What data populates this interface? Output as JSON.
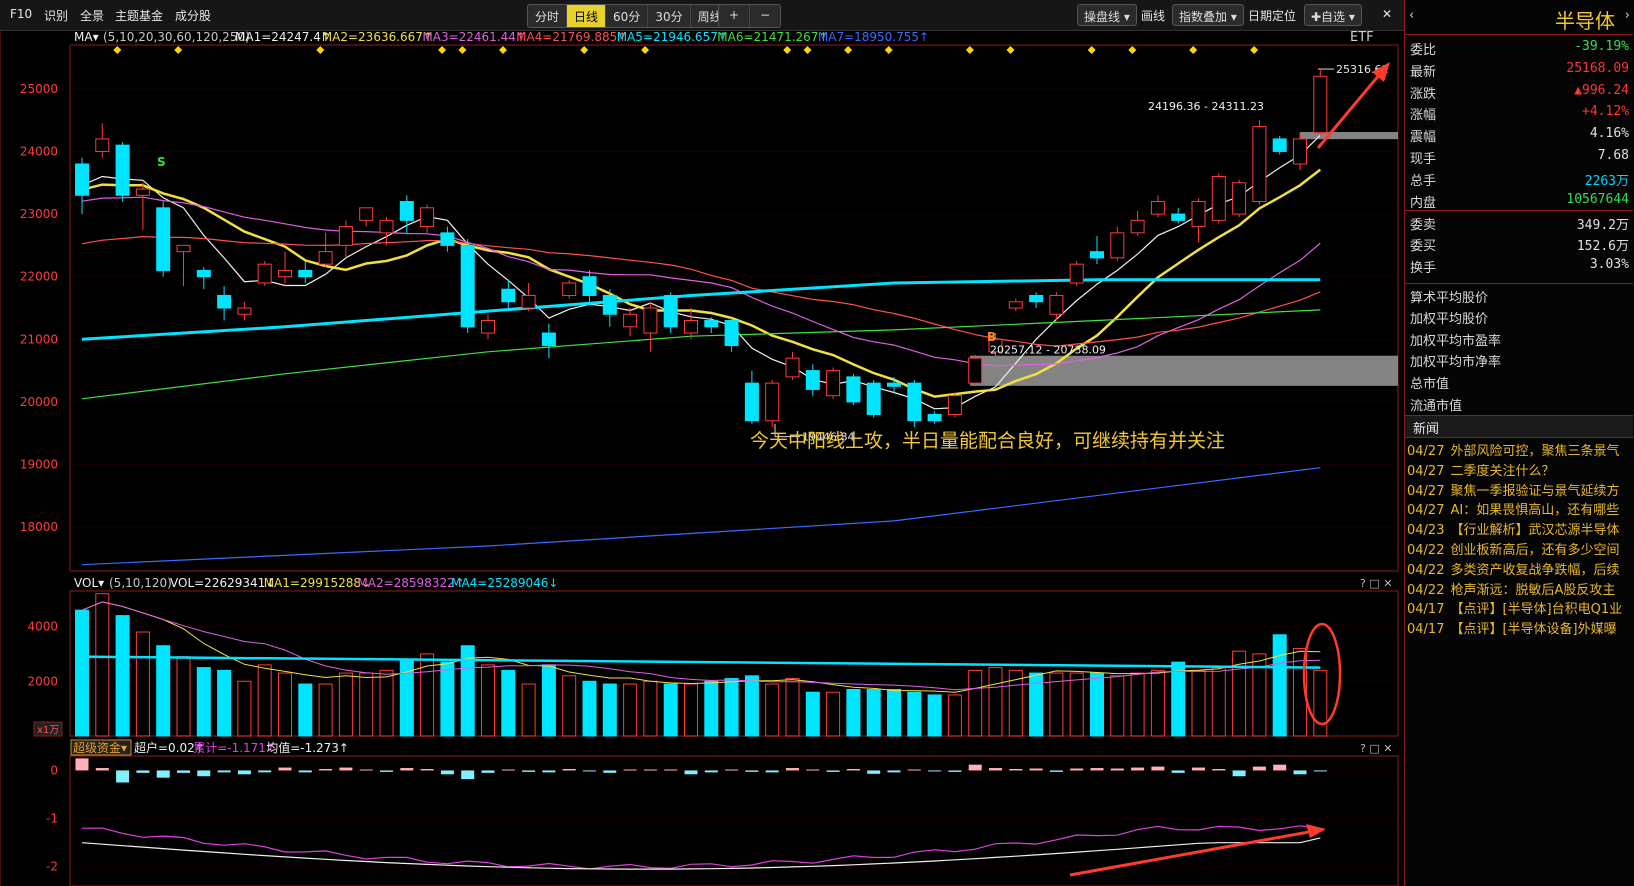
{
  "toolbar": {
    "f10": "F10",
    "identify": "识别",
    "overview": "全景",
    "theme_fund": "主题基金",
    "constituents": "成分股",
    "periods": [
      "分时",
      "日线",
      "60分",
      "30分",
      "周线 ▾"
    ],
    "active_period": 1,
    "zoom_in": "+",
    "zoom_out": "−",
    "chips": "操盘线 ▾",
    "draw": "画线",
    "index_overlay": "指数叠加 ▾",
    "date_locate": "日期定位",
    "add_fav": "✚自选 ▾",
    "close": "✕"
  },
  "main_header": {
    "ma_btn": "MA▾",
    "params": "(5,10,20,30,60,120,250)",
    "ma_values": [
      {
        "text": "MA1=24247.4↑",
        "color": "#f0f0f0"
      },
      {
        "text": "MA2=23636.667↑",
        "color": "#f0e040"
      },
      {
        "text": "MA3=22461.44↑",
        "color": "#e060e0"
      },
      {
        "text": "MA4=21769.885↑",
        "color": "#ff5050"
      },
      {
        "text": "MA5=21946.657↑",
        "color": "#00e5ff"
      },
      {
        "text": "MA6=21471.267↑",
        "color": "#40e040"
      },
      {
        "text": "MA7=18950.755↑",
        "color": "#3a6bff"
      }
    ],
    "etf": "ETF"
  },
  "annotations": {
    "high": "25316.61",
    "range1": "24196.36 - 24311.23",
    "range2": "20257.12 - 20738.09",
    "low": "19446.84",
    "comment": "今天中阳线上攻，半日量能配合良好，可继续持有并关注",
    "buy_marker": "B",
    "sell_marker": "S"
  },
  "vol_header": {
    "btn": "VOL▾",
    "params": "(5,10,120)",
    "values": [
      {
        "text": "VOL=22629341↓",
        "color": "#f0f0f0"
      },
      {
        "text": "MA1=29915288↓",
        "color": "#f0e040"
      },
      {
        "text": "MA2=28598322↑",
        "color": "#e060e0"
      },
      {
        "text": "MA4=25289046↓",
        "color": "#00e5ff"
      }
    ],
    "unit": "x1万"
  },
  "flow_header": {
    "btn": "超级资金▾",
    "values": [
      {
        "text": "超户=0.02↑",
        "color": "#f0f0f0"
      },
      {
        "text": "累计=-1.171↑",
        "color": "#e040e0"
      },
      {
        "text": "均值=-1.273↑",
        "color": "#f0f0f0"
      }
    ]
  },
  "panel_controls": "? □ ✕",
  "chart_data": [
    {
      "type": "candlestick",
      "y_ticks": [
        18000,
        19000,
        20000,
        21000,
        22000,
        23000,
        24000,
        25000
      ],
      "ylim": [
        17300,
        25700
      ],
      "candles": [
        [
          23800,
          23300,
          23000,
          23900
        ],
        [
          24000,
          24200,
          23900,
          24450
        ],
        [
          24100,
          23300,
          23200,
          24150
        ],
        [
          23300,
          23400,
          22750,
          23500
        ],
        [
          23100,
          22100,
          22000,
          23200
        ],
        [
          22400,
          22500,
          21850,
          22500
        ],
        [
          22100,
          22000,
          21800,
          22150
        ],
        [
          21700,
          21500,
          21300,
          21850
        ],
        [
          21400,
          21500,
          21300,
          21600
        ],
        [
          21900,
          22200,
          21850,
          22250
        ],
        [
          22000,
          22100,
          21900,
          22400
        ],
        [
          22100,
          22000,
          21900,
          22250
        ],
        [
          22200,
          22400,
          22150,
          22700
        ],
        [
          22500,
          22800,
          22300,
          22900
        ],
        [
          22900,
          23100,
          22800,
          23100
        ],
        [
          22700,
          22900,
          22500,
          22950
        ],
        [
          23200,
          22900,
          22700,
          23300
        ],
        [
          22800,
          23100,
          22700,
          23150
        ],
        [
          22700,
          22500,
          22400,
          22800
        ],
        [
          22500,
          21200,
          21100,
          22600
        ],
        [
          21100,
          21300,
          21000,
          21400
        ],
        [
          21800,
          21600,
          21500,
          21950
        ],
        [
          21500,
          21700,
          21450,
          21900
        ],
        [
          21100,
          20900,
          20700,
          21250
        ],
        [
          21700,
          21900,
          21650,
          21950
        ],
        [
          22000,
          21700,
          21600,
          22100
        ],
        [
          21700,
          21400,
          21200,
          21800
        ],
        [
          21200,
          21400,
          21050,
          21500
        ],
        [
          21100,
          21500,
          20800,
          21600
        ],
        [
          21700,
          21200,
          21100,
          21750
        ],
        [
          21100,
          21300,
          21000,
          21500
        ],
        [
          21300,
          21200,
          21100,
          21350
        ],
        [
          21300,
          20900,
          20800,
          21350
        ],
        [
          20300,
          19700,
          19650,
          20500
        ],
        [
          19700,
          20300,
          19600,
          20350
        ],
        [
          20400,
          20700,
          20350,
          20800
        ],
        [
          20500,
          20200,
          20100,
          20600
        ],
        [
          20100,
          20500,
          20050,
          20550
        ],
        [
          20400,
          20000,
          19950,
          20450
        ],
        [
          20300,
          19800,
          19750,
          20350
        ],
        [
          20300,
          20250,
          20150,
          20400
        ],
        [
          20300,
          19700,
          19600,
          20350
        ],
        [
          19800,
          19700,
          19650,
          19850
        ],
        [
          19800,
          20100,
          19750,
          20150
        ],
        [
          20300,
          20700,
          20250,
          20750
        ],
        [
          20800,
          21000,
          20700,
          21100
        ],
        [
          21500,
          21600,
          21450,
          21650
        ],
        [
          21700,
          21600,
          21500,
          21750
        ],
        [
          21400,
          21700,
          21300,
          21750
        ],
        [
          21900,
          22200,
          21850,
          22250
        ],
        [
          22400,
          22300,
          22200,
          22650
        ],
        [
          22300,
          22700,
          22250,
          22800
        ],
        [
          22700,
          22900,
          22650,
          23050
        ],
        [
          23000,
          23200,
          22950,
          23300
        ],
        [
          23000,
          22900,
          22850,
          23100
        ],
        [
          22800,
          23200,
          22550,
          23250
        ],
        [
          22900,
          23600,
          22850,
          23650
        ],
        [
          23000,
          23500,
          22950,
          23550
        ],
        [
          23200,
          24400,
          23150,
          24500
        ],
        [
          24200,
          24000,
          23950,
          24250
        ],
        [
          23800,
          24200,
          23700,
          24300
        ],
        [
          24300,
          25200,
          24250,
          25300
        ]
      ],
      "ma_series": [
        {
          "name": "MA1",
          "color": "#f0f0f0"
        },
        {
          "name": "MA2",
          "color": "#f0e040"
        },
        {
          "name": "MA3",
          "color": "#e060e0"
        },
        {
          "name": "MA4",
          "color": "#ff5050"
        },
        {
          "name": "MA5",
          "color": "#00e5ff"
        },
        {
          "name": "MA6",
          "color": "#40e040"
        },
        {
          "name": "MA7",
          "color": "#3a6bff"
        }
      ]
    },
    {
      "type": "bar",
      "y_ticks": [
        2000,
        4000
      ],
      "ylim": [
        0,
        5300
      ],
      "volumes": [
        4600,
        5200,
        4400,
        3800,
        3300,
        2900,
        2500,
        2400,
        2000,
        2600,
        2300,
        1900,
        1900,
        2300,
        2300,
        2400,
        2800,
        3000,
        2700,
        3300,
        2600,
        2400,
        1900,
        2600,
        2200,
        2000,
        1900,
        1900,
        2000,
        1900,
        1900,
        2000,
        2100,
        2200,
        1900,
        2100,
        1600,
        1600,
        1700,
        1700,
        1700,
        1600,
        1500,
        1500,
        2400,
        2500,
        2400,
        2300,
        2300,
        2300,
        2300,
        2200,
        2300,
        2400,
        2700,
        2400,
        2500,
        3100,
        3000,
        3700,
        3200,
        2400
      ],
      "ma_volume": [
        {
          "name": "MA1",
          "color": "#f0e040"
        },
        {
          "name": "MA2",
          "color": "#e060e0"
        },
        {
          "name": "MA4",
          "color": "#00e5ff",
          "values": [
            2900,
            2500
          ]
        }
      ]
    },
    {
      "type": "bar",
      "y_ticks": [
        0,
        -1,
        -2
      ],
      "ylim": [
        -2.4,
        0.3
      ],
      "flows": [
        0.25,
        0.05,
        -0.25,
        -0.05,
        -0.15,
        -0.05,
        -0.12,
        -0.04,
        -0.08,
        -0.04,
        0.06,
        -0.04,
        0.03,
        0.06,
        0.02,
        -0.03,
        0.05,
        0.03,
        -0.08,
        -0.18,
        -0.05,
        0.02,
        -0.03,
        -0.04,
        0.03,
        -0.02,
        -0.05,
        0.02,
        0.02,
        0.02,
        -0.08,
        -0.04,
        0.02,
        -0.03,
        -0.04,
        0.05,
        0.02,
        -0.03,
        0.03,
        -0.07,
        -0.04,
        0.02,
        -0.02,
        -0.03,
        0.12,
        0.05,
        0.03,
        0.04,
        -0.03,
        0.04,
        0.05,
        0.04,
        0.06,
        0.08,
        -0.05,
        0.06,
        0.03,
        -0.12,
        0.08,
        0.12,
        -0.08,
        -0.02
      ],
      "cum_range": [
        -1.4,
        -1.2
      ]
    }
  ],
  "right_panel": {
    "title": "半导体",
    "quotes": [
      {
        "label": "委比",
        "value": "-39.19%",
        "color": "#2fe04f"
      },
      {
        "label": "最新",
        "value": "25168.09",
        "color": "#ff3333"
      },
      {
        "label": "涨跌",
        "value": "▲996.24",
        "color": "#ff3333"
      },
      {
        "label": "涨幅",
        "value": "+4.12%",
        "color": "#ff3333"
      },
      {
        "label": "震幅",
        "value": "4.16%",
        "color": "#e0e0e0"
      },
      {
        "label": "现手",
        "value": "7.68",
        "color": "#e0e0e0"
      },
      {
        "label": "总手",
        "value": "2263万",
        "color": "#00d8ff"
      },
      {
        "label": "内盘",
        "value": "10567644",
        "color": "#2fe04f"
      },
      {
        "label": "委卖",
        "value": "349.2万",
        "color": "#e0e0e0"
      },
      {
        "label": "委买",
        "value": "152.6万",
        "color": "#e0e0e0"
      },
      {
        "label": "换手",
        "value": "3.03%",
        "color": "#e0e0e0"
      }
    ],
    "links": [
      "算术平均股价",
      "加权平均股价",
      "加权平均市盈率",
      "加权平均市净率",
      "总市值",
      "流通市值"
    ],
    "news_title": "新闻",
    "news": [
      {
        "date": "04/27",
        "title": "外部风险可控，聚焦三条景气"
      },
      {
        "date": "04/27",
        "title": "二季度关注什么？"
      },
      {
        "date": "04/27",
        "title": "聚焦一季报验证与景气延续方"
      },
      {
        "date": "04/27",
        "title": "AI：如果畏惧高山，还有哪些"
      },
      {
        "date": "04/23",
        "title": "【行业解析】武汉芯源半导体"
      },
      {
        "date": "04/22",
        "title": "创业板新高后，还有多少空间"
      },
      {
        "date": "04/22",
        "title": "多类资产收复战争跌幅，后续"
      },
      {
        "date": "04/22",
        "title": "枪声渐远：脱敏后A股反攻主"
      },
      {
        "date": "04/17",
        "title": "【点评】[半导体]台积电Q1业"
      },
      {
        "date": "04/17",
        "title": "【点评】[半导体设备]外媒曝"
      }
    ]
  }
}
